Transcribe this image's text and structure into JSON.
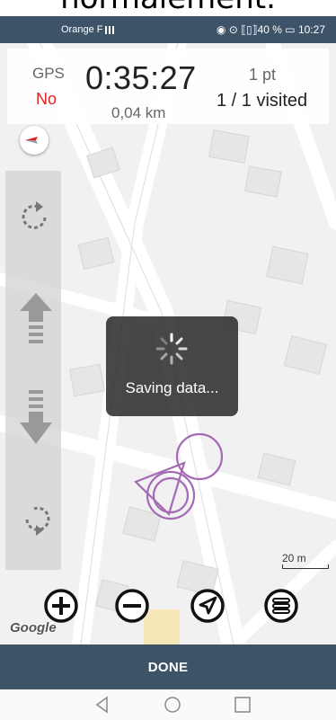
{
  "caption": "normalement.",
  "status_bar": {
    "carrier": "Orange F",
    "right_text": "◉ ⊙ ⟦▯⟧40 % ▭ 10:27"
  },
  "tracker": {
    "gps_label": "GPS",
    "gps_status": "No",
    "timer": "0:35:27",
    "distance": "0,04 km",
    "points": "1 pt",
    "visited": "1 / 1 visited"
  },
  "loading": {
    "message": "Saving data..."
  },
  "map": {
    "scale_label": "20 m",
    "attribution": "Google"
  },
  "controls": {
    "zoom_in": "zoom-in-icon",
    "zoom_out": "zoom-out-icon",
    "locate": "navigate-icon",
    "layers": "layers-icon"
  },
  "side_controls": [
    "rotate-ccw-icon",
    "move-up-icon",
    "move-down-icon",
    "rotate-cw-icon"
  ],
  "done_button": "DONE",
  "colors": {
    "bar_bg": "#3c5368",
    "gps_no": "#dd2222",
    "track": "#a46ab4"
  }
}
